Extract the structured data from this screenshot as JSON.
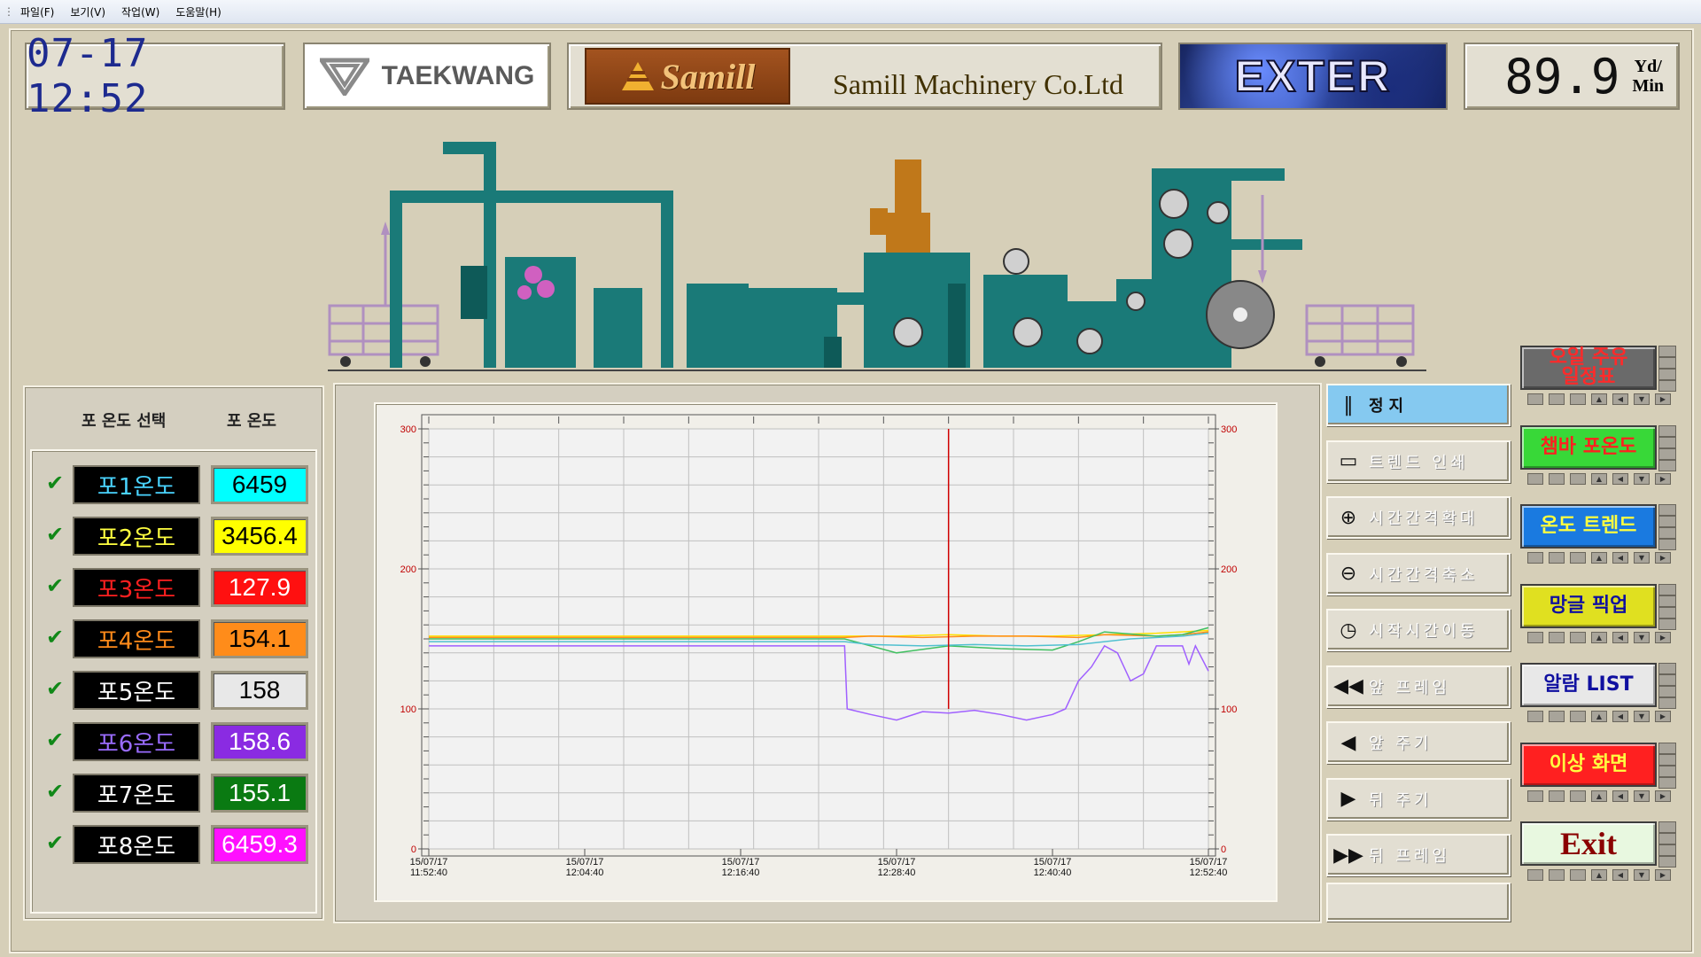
{
  "menu": [
    "파일(F)",
    "보기(V)",
    "작업(W)",
    "도움말(H)"
  ],
  "header": {
    "datetime": "07-17 12:52",
    "partner_logo": "TAEKWANG",
    "maker_logo": "Samill",
    "company": "Samill Machinery Co.Ltd",
    "product_logo": "EXTER",
    "speed_value": "89.9",
    "speed_unit_top": "Yd/",
    "speed_unit_bottom": "Min"
  },
  "temp_panel": {
    "col_select": "포 온도 선택",
    "col_temp": "포 온도",
    "rows": [
      {
        "name": "포1온도",
        "value": "6459",
        "name_color": "#4ad4ff",
        "bg": "#00ffff",
        "fg": "#000000"
      },
      {
        "name": "포2온도",
        "value": "3456.4",
        "name_color": "#ffff40",
        "bg": "#ffff00",
        "fg": "#000000"
      },
      {
        "name": "포3온도",
        "value": "127.9",
        "name_color": "#ff2020",
        "bg": "#ff1010",
        "fg": "#ffffff"
      },
      {
        "name": "포4온도",
        "value": "154.1",
        "name_color": "#ff8a1a",
        "bg": "#ff8c1a",
        "fg": "#000000"
      },
      {
        "name": "포5온도",
        "value": "158",
        "name_color": "#ffffff",
        "bg": "#e8e8e8",
        "fg": "#000000"
      },
      {
        "name": "포6온도",
        "value": "158.6",
        "name_color": "#9a6cff",
        "bg": "#8a2be2",
        "fg": "#ffffff"
      },
      {
        "name": "포7온도",
        "value": "155.1",
        "name_color": "#ffffff",
        "bg": "#0a7a12",
        "fg": "#ffffff"
      },
      {
        "name": "포8온도",
        "value": "6459.3",
        "name_color": "#ffffff",
        "bg": "#ff10ff",
        "fg": "#ffffff"
      }
    ]
  },
  "chart_data": {
    "type": "line",
    "ylim": [
      0,
      300
    ],
    "y_ticks": [
      0,
      100,
      200,
      300
    ],
    "x_ticks": [
      "15/07/17 11:52:40",
      "15/07/17 12:04:40",
      "15/07/17 12:16:40",
      "15/07/17 12:28:40",
      "15/07/17 12:40:40",
      "15/07/17 12:52:40"
    ],
    "x_minutes": [
      0,
      12,
      24,
      36,
      48,
      60
    ],
    "cursor_minute": 40,
    "grid": true,
    "series": [
      {
        "color": "#ffe000",
        "x": [
          0,
          32,
          36,
          40,
          44,
          48,
          52,
          56,
          60
        ],
        "y": [
          152,
          152,
          152,
          153,
          152,
          152,
          153,
          154,
          156
        ]
      },
      {
        "color": "#ff8c1a",
        "x": [
          0,
          32,
          34,
          38,
          42,
          46,
          50,
          52,
          56,
          58,
          60
        ],
        "y": [
          151,
          151,
          152,
          151,
          152,
          152,
          151,
          153,
          152,
          153,
          155
        ]
      },
      {
        "color": "#40c060",
        "x": [
          0,
          32,
          34,
          36,
          40,
          44,
          48,
          50,
          52,
          56,
          58,
          60
        ],
        "y": [
          150,
          150,
          145,
          140,
          145,
          143,
          142,
          148,
          155,
          152,
          153,
          158
        ]
      },
      {
        "color": "#50c0d0",
        "x": [
          0,
          32,
          34,
          38,
          42,
          46,
          50,
          54,
          58,
          60
        ],
        "y": [
          148,
          148,
          146,
          145,
          146,
          145,
          146,
          150,
          152,
          154
        ]
      },
      {
        "color": "#a060ff",
        "x": [
          0,
          32,
          32.2,
          34,
          36,
          38,
          40,
          42,
          44,
          46,
          48,
          49,
          50,
          51,
          52,
          53,
          54,
          55,
          56,
          57,
          58,
          58.5,
          59,
          60
        ],
        "y": [
          145,
          145,
          100,
          96,
          92,
          98,
          97,
          99,
          96,
          92,
          96,
          100,
          120,
          130,
          145,
          140,
          120,
          125,
          145,
          145,
          145,
          132,
          145,
          127
        ]
      }
    ]
  },
  "controls": [
    {
      "label": "정지",
      "icon": "pause-icon",
      "active": true
    },
    {
      "label": "트렌드 인쇄",
      "icon": "print-icon",
      "active": false
    },
    {
      "label": "시간간격확대",
      "icon": "zoom-in-icon",
      "active": false
    },
    {
      "label": "시간간격축소",
      "icon": "zoom-out-icon",
      "active": false
    },
    {
      "label": "시작시간이동",
      "icon": "clock-icon",
      "active": false
    },
    {
      "label": "앞 프레임",
      "icon": "rewind-icon",
      "active": false
    },
    {
      "label": "앞 주기",
      "icon": "step-back-icon",
      "active": false
    },
    {
      "label": "뒤 주기",
      "icon": "step-forward-icon",
      "active": false
    },
    {
      "label": "뒤 프레임",
      "icon": "fast-forward-icon",
      "active": false
    }
  ],
  "nav_buttons": [
    {
      "label": "오일 주유\n일정표",
      "bg": "#6a6a6a",
      "fg": "#ff2a2a"
    },
    {
      "label": "챔바 포온도",
      "bg": "#38d838",
      "fg": "#ff2020"
    },
    {
      "label": "온도 트렌드",
      "bg": "#1a7ae0",
      "fg": "#ffff40"
    },
    {
      "label": "망글 픽업",
      "bg": "#e0e020",
      "fg": "#1010a0"
    },
    {
      "label": "알람 LIST",
      "bg": "#e8e8e8",
      "fg": "#1010a0"
    },
    {
      "label": "이상 화면",
      "bg": "#ff2020",
      "fg": "#ffff40"
    },
    {
      "label": "Exit",
      "bg": "#e8f8e0",
      "fg": "#8a0000"
    }
  ],
  "colors": {
    "machine": "#1a7a78",
    "machine_dark": "#0e5a58",
    "orange": "#c0781a",
    "purple": "#c080d0"
  }
}
